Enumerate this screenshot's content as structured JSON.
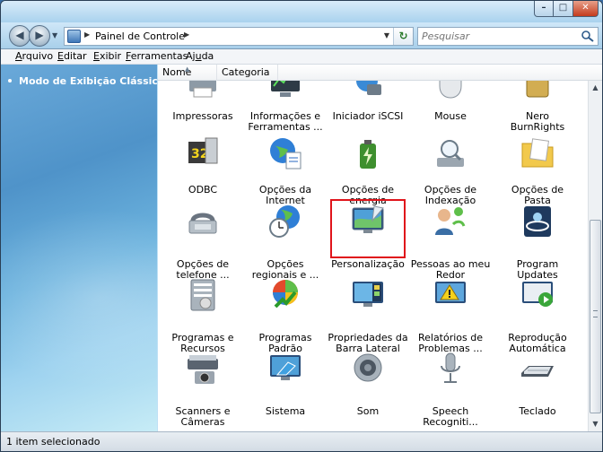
{
  "window": {
    "controls": {
      "minimize": "–",
      "maximize": "□",
      "close": "✕"
    }
  },
  "nav": {
    "back_glyph": "◀",
    "forward_glyph": "▶",
    "address": {
      "path_text": "Painel de Controle",
      "separator": "▶",
      "chevron": "▶",
      "dropdown": "▼",
      "refresh_glyph": "↻"
    },
    "search": {
      "placeholder": "Pesquisar"
    }
  },
  "menu": [
    {
      "label": "Arquivo",
      "hotkey": "A",
      "rest": "rquivo"
    },
    {
      "label": "Editar",
      "hotkey": "E",
      "rest": "ditar"
    },
    {
      "label": "Exibir",
      "hotkey": "E",
      "rest": "xibir"
    },
    {
      "label": "Ferramentas",
      "hotkey": "F",
      "rest": "erramentas"
    },
    {
      "label": "Ajuda",
      "pre": "Aj",
      "hotkey": "u",
      "rest": "da"
    }
  ],
  "sidebar": {
    "classic_view_link": "Modo de Exibição Clássico"
  },
  "columns": {
    "name": "Nome",
    "category": "Categoria"
  },
  "items": [
    {
      "label1": "Impressoras",
      "label2": "",
      "icon": "printer-icon"
    },
    {
      "label1": "Informações e",
      "label2": "Ferramentas ...",
      "icon": "performance-info-icon"
    },
    {
      "label1": "Iniciador iSCSI",
      "label2": "",
      "icon": "iscsi-icon"
    },
    {
      "label1": "Mouse",
      "label2": "",
      "icon": "mouse-icon"
    },
    {
      "label1": "Nero BurnRights",
      "label2": "",
      "icon": "nero-lock-icon"
    },
    {
      "label1": "ODBC",
      "label2": "",
      "icon": "odbc-icon"
    },
    {
      "label1": "Opções da",
      "label2": "Internet",
      "icon": "internet-options-icon"
    },
    {
      "label1": "Opções de",
      "label2": "energia",
      "icon": "power-options-icon"
    },
    {
      "label1": "Opções de",
      "label2": "Indexação",
      "icon": "indexing-icon"
    },
    {
      "label1": "Opções de Pasta",
      "label2": "",
      "icon": "folder-options-icon"
    },
    {
      "label1": "Opções de",
      "label2": "telefone ...",
      "icon": "phone-modem-icon"
    },
    {
      "label1": "Opções",
      "label2": "regionais e ...",
      "icon": "regional-options-icon"
    },
    {
      "label1": "Personalização",
      "label2": "",
      "icon": "personalization-icon",
      "selected": true
    },
    {
      "label1": "Pessoas ao meu",
      "label2": "Redor",
      "icon": "people-near-me-icon"
    },
    {
      "label1": "Program",
      "label2": "Updates",
      "icon": "program-updates-icon"
    },
    {
      "label1": "Programas e",
      "label2": "Recursos",
      "icon": "programs-features-icon"
    },
    {
      "label1": "Programas",
      "label2": "Padrão",
      "icon": "default-programs-icon"
    },
    {
      "label1": "Propriedades da",
      "label2": "Barra Lateral d...",
      "icon": "sidebar-properties-icon"
    },
    {
      "label1": "Relatórios de",
      "label2": "Problemas ...",
      "icon": "problem-reports-icon"
    },
    {
      "label1": "Reprodução",
      "label2": "Automática",
      "icon": "autoplay-icon"
    },
    {
      "label1": "Scanners e",
      "label2": "Câmeras",
      "icon": "scanner-camera-icon"
    },
    {
      "label1": "Sistema",
      "label2": "",
      "icon": "system-icon"
    },
    {
      "label1": "Som",
      "label2": "",
      "icon": "sound-icon"
    },
    {
      "label1": "Speech",
      "label2": "Recogniti...",
      "icon": "speech-microphone-icon"
    },
    {
      "label1": "Teclado",
      "label2": "",
      "icon": "keyboard-icon"
    }
  ],
  "status": {
    "text": "1 item selecionado"
  },
  "colors": {
    "selection_border": "#e0141b",
    "sidebar_top": "#4f93c9",
    "sidebar_bottom": "#c7ecf6"
  }
}
